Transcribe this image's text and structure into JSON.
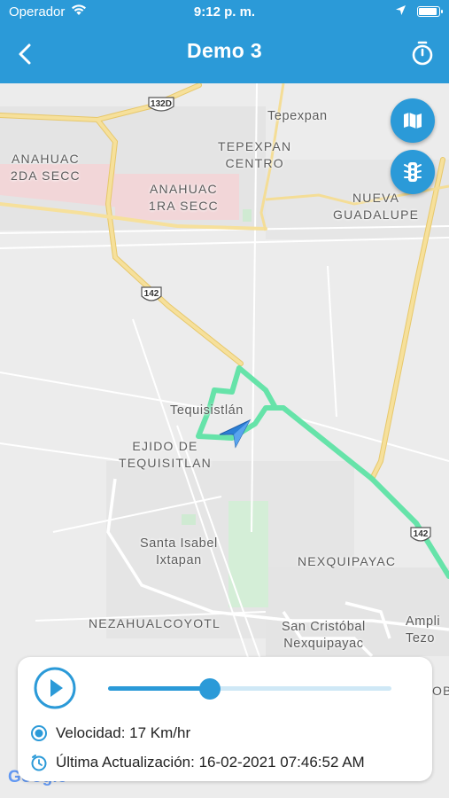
{
  "status_bar": {
    "carrier": "Operador",
    "time": "9:12 p. m."
  },
  "nav": {
    "title": "Demo 3",
    "back_icon": "chevron-left-icon",
    "timer_icon": "stopwatch-icon"
  },
  "map": {
    "labels": {
      "anahuac2": "ANAHUAC\n2DA SECC",
      "anahuac1": "ANAHUAC\n1RA SECC",
      "tepexpan": "Tepexpan",
      "tepexpan_centro": "TEPEXPAN\nCENTRO",
      "nueva_guadalupe": "NUEVA\nGUADALUPE",
      "tequisistlan": "Tequisistlán",
      "ejido": "EJIDO DE\nTEQUISITLAN",
      "santa_isabel": "Santa Isabel\nIxtapan",
      "nexquipayac": "NEXQUIPAYAC",
      "nezahualcoyotl": "NEZAHUALCOYOTL",
      "san_cristobal": "San Cristóbal\nNexquipayac",
      "ampli": "Ampli\nTezo",
      "edge_ob": "OB"
    },
    "shields": {
      "s132d": "132D",
      "s142a": "142",
      "s142b": "142"
    },
    "buttons": {
      "layers_icon": "map-icon",
      "traffic_icon": "traffic-light-icon"
    },
    "attribution": "Google",
    "colors": {
      "route": "#5fe3a5",
      "highway": "#f3d77e",
      "accent": "#2b9ad8"
    }
  },
  "panel": {
    "play_icon": "play-icon",
    "progress": 0.36,
    "speed": "Velocidad: 17 Km/hr",
    "last_update": "Última Actualización: 16-02-2021 07:46:52 AM"
  }
}
